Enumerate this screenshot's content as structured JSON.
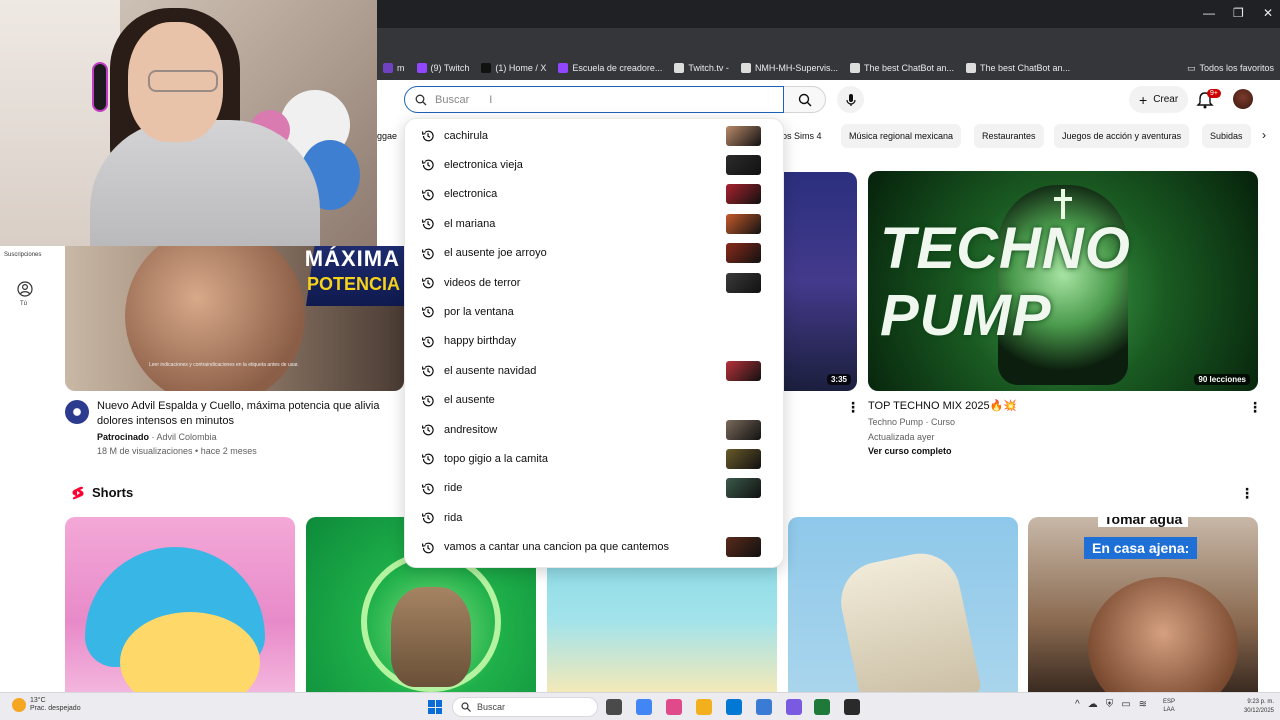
{
  "bookmarks": [
    {
      "label": "m",
      "color": "#6f42c1"
    },
    {
      "label": "(9) Twitch",
      "color": "#9146ff"
    },
    {
      "label": "(1) Home / X",
      "color": "#111111"
    },
    {
      "label": "Escuela de creadore...",
      "color": "#9146ff"
    },
    {
      "label": "Twitch.tv -",
      "color": "#dddddd"
    },
    {
      "label": "NMH-MH-Supervis...",
      "color": "#dddddd"
    },
    {
      "label": "The best ChatBot an...",
      "color": "#dddddd"
    },
    {
      "label": "The best ChatBot an...",
      "color": "#dddddd"
    }
  ],
  "bookmarks_right": "Todos los favoritos",
  "header": {
    "search_placeholder": "Buscar",
    "create_label": "Crear",
    "notif_count": "9+"
  },
  "chips": [
    "ggae",
    "os Sims 4",
    "Música regional mexicana",
    "Restaurantes",
    "Juegos de acción y aventuras",
    "Subidas"
  ],
  "sidebar": {
    "label": "Suscripciones",
    "you_label": "Tú"
  },
  "ad_video": {
    "banner_1": "MÁXIMA",
    "banner_2": "POTENCIA",
    "fine_print": "Leer indicaciones y contraindicaciones en la etiqueta antes de usar.",
    "title": "Nuevo Advil Espalda y Cuello, máxima potencia que alivia dolores intensos en minutos",
    "sponsored": "Patrocinado",
    "channel": "Advil Colombia",
    "meta": "18 M de visualizaciones • hace 2 meses"
  },
  "mid_video": {
    "duration": "3:35"
  },
  "techno_video": {
    "thumb_text": "TECHNO PUMP",
    "badge": "90 lecciones",
    "title": "TOP TECHNO MIX 2025🔥💥",
    "channel": "Techno Pump · Curso",
    "updated": "Actualizada ayer",
    "cta": "Ver curso completo"
  },
  "shorts": {
    "heading": "Shorts",
    "s5_caption_top": "Tomar agua",
    "s5_caption": "En casa ajena:"
  },
  "suggestions": [
    {
      "text": "cachirula",
      "thumb": "#b98a6a"
    },
    {
      "text": "electronica vieja",
      "thumb": "#2b2b2b"
    },
    {
      "text": "electronica",
      "thumb": "#a8222e"
    },
    {
      "text": "el mariana",
      "thumb": "#c45a2a"
    },
    {
      "text": "el ausente joe arroyo",
      "thumb": "#8a2a1a"
    },
    {
      "text": "videos de terror",
      "thumb": "#3a3a3a"
    },
    {
      "text": "por la ventana",
      "thumb": ""
    },
    {
      "text": "happy birthday",
      "thumb": ""
    },
    {
      "text": "el ausente navidad",
      "thumb": "#b8323a"
    },
    {
      "text": "el ausente",
      "thumb": ""
    },
    {
      "text": "andresitow",
      "thumb": "#7a6a5a"
    },
    {
      "text": "topo gigio a la camita",
      "thumb": "#6a5a2a"
    },
    {
      "text": "ride",
      "thumb": "#3a5a4a"
    },
    {
      "text": "rida",
      "thumb": ""
    },
    {
      "text": "vamos a cantar una cancion pa que cantemos",
      "thumb": "#5a2a1a"
    }
  ],
  "taskbar": {
    "temp": "13°C",
    "weather": "Prac. despejado",
    "search": "Buscar",
    "lang_1": "ESP",
    "lang_2": "LAA",
    "time": "9:23 p. m.",
    "date": "30/12/2025",
    "apps": [
      "#4a4a4a",
      "#4285f4",
      "#e04a8a",
      "#f2b01e",
      "#0078d4",
      "#3a7bd5",
      "#7a5ae0",
      "#1f7a3a",
      "#2a2a2a"
    ]
  }
}
